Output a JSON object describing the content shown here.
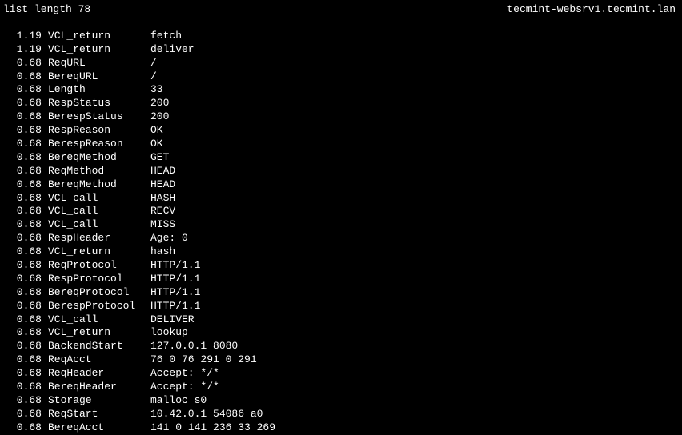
{
  "header": {
    "left": "list length 78",
    "right": "tecmint-websrv1.tecmint.lan"
  },
  "rows": [
    {
      "val": "1.19",
      "tag": "VCL_return",
      "data": "fetch"
    },
    {
      "val": "1.19",
      "tag": "VCL_return",
      "data": "deliver"
    },
    {
      "val": "0.68",
      "tag": "ReqURL",
      "data": "/"
    },
    {
      "val": "0.68",
      "tag": "BereqURL",
      "data": "/"
    },
    {
      "val": "0.68",
      "tag": "Length",
      "data": "33"
    },
    {
      "val": "0.68",
      "tag": "RespStatus",
      "data": "200"
    },
    {
      "val": "0.68",
      "tag": "BerespStatus",
      "data": "200"
    },
    {
      "val": "0.68",
      "tag": "RespReason",
      "data": "OK"
    },
    {
      "val": "0.68",
      "tag": "BerespReason",
      "data": "OK"
    },
    {
      "val": "0.68",
      "tag": "BereqMethod",
      "data": "GET"
    },
    {
      "val": "0.68",
      "tag": "ReqMethod",
      "data": "HEAD"
    },
    {
      "val": "0.68",
      "tag": "BereqMethod",
      "data": "HEAD"
    },
    {
      "val": "0.68",
      "tag": "VCL_call",
      "data": "HASH"
    },
    {
      "val": "0.68",
      "tag": "VCL_call",
      "data": "RECV"
    },
    {
      "val": "0.68",
      "tag": "VCL_call",
      "data": "MISS"
    },
    {
      "val": "0.68",
      "tag": "RespHeader",
      "data": "Age: 0"
    },
    {
      "val": "0.68",
      "tag": "VCL_return",
      "data": "hash"
    },
    {
      "val": "0.68",
      "tag": "ReqProtocol",
      "data": "HTTP/1.1"
    },
    {
      "val": "0.68",
      "tag": "RespProtocol",
      "data": "HTTP/1.1"
    },
    {
      "val": "0.68",
      "tag": "BereqProtocol",
      "data": "HTTP/1.1"
    },
    {
      "val": "0.68",
      "tag": "BerespProtocol",
      "data": "HTTP/1.1"
    },
    {
      "val": "0.68",
      "tag": "VCL_call",
      "data": "DELIVER"
    },
    {
      "val": "0.68",
      "tag": "VCL_return",
      "data": "lookup"
    },
    {
      "val": "0.68",
      "tag": "BackendStart",
      "data": "127.0.0.1 8080"
    },
    {
      "val": "0.68",
      "tag": "ReqAcct",
      "data": "76 0 76 291 0 291"
    },
    {
      "val": "0.68",
      "tag": "ReqHeader",
      "data": "Accept: */*"
    },
    {
      "val": "0.68",
      "tag": "BereqHeader",
      "data": "Accept: */*"
    },
    {
      "val": "0.68",
      "tag": "Storage",
      "data": "malloc s0"
    },
    {
      "val": "0.68",
      "tag": "ReqStart",
      "data": "10.42.0.1 54086 a0"
    },
    {
      "val": "0.68",
      "tag": "BereqAcct",
      "data": "141 0 141 236 33 269"
    }
  ]
}
